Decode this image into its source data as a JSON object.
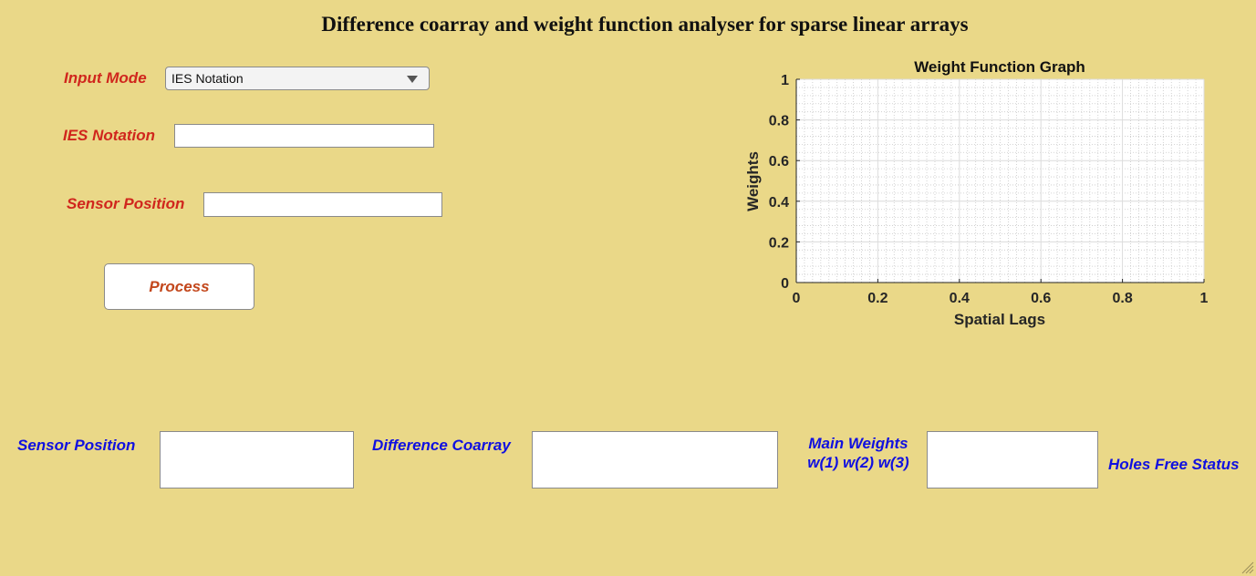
{
  "title": "Difference coarray and weight function analyser for sparse linear arrays",
  "input_mode": {
    "label": "Input Mode",
    "selected": "IES Notation"
  },
  "ies_notation": {
    "label": "IES Notation",
    "value": ""
  },
  "sensor_position_input": {
    "label": "Sensor Position",
    "value": ""
  },
  "process_button": {
    "label": "Process"
  },
  "outputs": {
    "sensor_position": {
      "label": "Sensor Position"
    },
    "difference_coarray": {
      "label": "Difference Coarray"
    },
    "main_weights": {
      "label_line1": "Main Weights",
      "label_line2": "w(1) w(2) w(3)"
    },
    "holes_free_status": {
      "label": "Holes Free Status"
    }
  },
  "chart_data": {
    "type": "line",
    "title": "Weight Function Graph",
    "xlabel": "Spatial Lags",
    "ylabel": "Weights",
    "xlim": [
      0,
      1
    ],
    "ylim": [
      0,
      1
    ],
    "xticks": [
      "0",
      "0.2",
      "0.4",
      "0.6",
      "0.8",
      "1"
    ],
    "yticks": [
      "0",
      "0.2",
      "0.4",
      "0.6",
      "0.8",
      "1"
    ],
    "grid": true,
    "minor_grid": true,
    "series": []
  }
}
